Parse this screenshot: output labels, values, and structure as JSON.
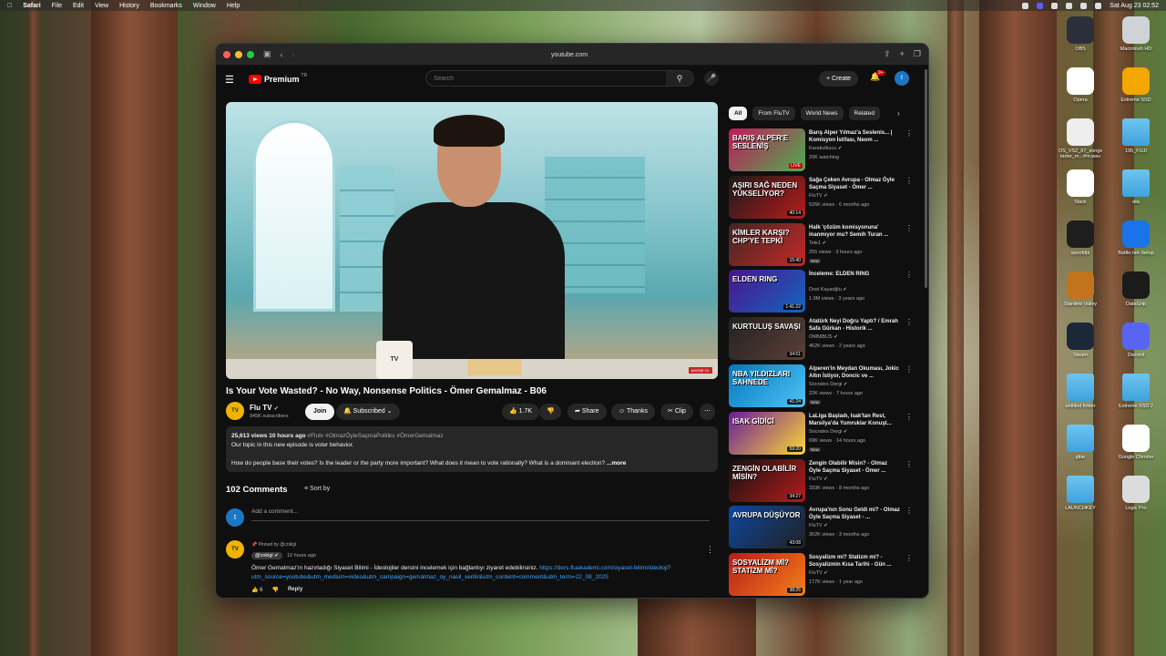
{
  "menubar": {
    "app": "Safari",
    "items": [
      "File",
      "Edit",
      "View",
      "History",
      "Bookmarks",
      "Window",
      "Help"
    ],
    "clock": "Sat Aug 23  02:52"
  },
  "browser": {
    "url": "youtube.com"
  },
  "yt": {
    "logo": "Premium",
    "logo_country": "TR",
    "search_placeholder": "Search",
    "create_label": "Create",
    "notif_count": "9+",
    "avatar_letter": "t"
  },
  "video": {
    "mug_text": "TV",
    "badge": "ABONE OL",
    "title": "Is Your Vote Wasted? - No Way, Nonsense Politics - Ömer Gemalmaz - B06",
    "channel": "Flu TV",
    "channel_avatar": "TV",
    "subs": "945K subscribers",
    "join": "Join",
    "subscribed": "Subscribed",
    "likes": "1.7K",
    "share": "Share",
    "thanks": "Thanks",
    "clip": "Clip"
  },
  "description": {
    "meta": "25,613 views  10 hours ago",
    "tags": "#Flutv #OlmazÖyleSaçmaPolitiks #ÖmerGemalmaz",
    "line1": "Our topic in this new episode is voter behavior.",
    "line2": "How do people base their votes? Is the leader or the party more important? What does it mean to vote rationally? What is a dominant election?",
    "more": "...more"
  },
  "comments": {
    "header": "102 Comments",
    "sort": "Sort by",
    "my_avatar": "t",
    "add_placeholder": "Add a comment...",
    "pinned_by": "Pinned by @cnklgl",
    "author": "@cnklgl",
    "time": "10 hours ago",
    "text": "Ömer Gemalmaz'ın hazırladığı Siyaset Bilimi - İdeolojiler dersini incelemek için bağlantıyı ziyaret edebilirsiniz.",
    "link": "https://ders.fluakademi.com/siyaset-bilimi/ideoloji?utm_source=youtube&utm_medium=video&utm_campaign=gemalmaz_oy_nasil_verilir&utm_content=comment&utm_term=22_08_2025",
    "likes": "6",
    "reply": "Reply"
  },
  "chips": [
    "All",
    "From FluTV",
    "World News",
    "Related"
  ],
  "recommendations": [
    {
      "title": "Barış Alper Yılmaz'a Seslenis... | Komisyon İstifası, Neom ...",
      "channel": "Karakulkucu",
      "meta": "20K watching",
      "thumb_text": "BARIŞ ALPER'E SESLENİŞ",
      "dur": "LIVE",
      "new": "",
      "c1": "#c2185b",
      "c2": "#4caf50"
    },
    {
      "title": "Sağa Çeken Avrupa - Olmaz Öyle Saçma Siyaset - Ömer ...",
      "channel": "FluTV",
      "meta": "526K views · 6 months ago",
      "thumb_text": "AŞIRI SAĞ NEDEN YÜKSELİYOR?",
      "dur": "40:14",
      "new": "",
      "c1": "#1a1a1a",
      "c2": "#b71c1c"
    },
    {
      "title": "Halk 'çözüm komisyonuna' inanmıyor mu? Semih Turan ...",
      "channel": "Tele1",
      "meta": "255 views · 3 hours ago",
      "thumb_text": "KİMLER KARŞI? CHP'YE TEPKİ",
      "dur": "15:40",
      "new": "New",
      "c1": "#3e2723",
      "c2": "#c62828"
    },
    {
      "title": "İnceleme: ELDEN RING",
      "channel": "Dost Kayaoğlu",
      "meta": "1.9M views · 3 years ago",
      "thumb_text": "ELDEN RING",
      "dur": "1:41:22",
      "new": "",
      "c1": "#4a148c",
      "c2": "#1565c0"
    },
    {
      "title": "Atatürk Neyi Doğru Yaptı? / Emrah Safa Gürkan - Historik ...",
      "channel": "OMNIBUS",
      "meta": "452K views · 2 years ago",
      "thumb_text": "KURTULUŞ SAVAŞI",
      "dur": "34:51",
      "new": "",
      "c1": "#212121",
      "c2": "#5d4037"
    },
    {
      "title": "Alperen'in Meydan Okuması, Jokic Altın İstiyor, Doncic ve ...",
      "channel": "Socrates Dergi",
      "meta": "22K views · 7 hours ago",
      "thumb_text": "NBA YILDIZLARI SAHNEDE",
      "dur": "41:24",
      "new": "New",
      "c1": "#0277bd",
      "c2": "#4fc3f7"
    },
    {
      "title": "LaLiga Başladı, Isak'tan Rest, Marsilya'da Yumruklar Konuşt...",
      "channel": "Socrates Dergi",
      "meta": "69K views · 14 hours ago",
      "thumb_text": "ISAK GİDİCİ",
      "dur": "59:20",
      "new": "New",
      "c1": "#6a1b9a",
      "c2": "#fdd835"
    },
    {
      "title": "Zengin Olabilir Misin? - Olmaz Öyle Saçma Siyaset - Ömer ...",
      "channel": "FluTV",
      "meta": "333K views · 8 months ago",
      "thumb_text": "ZENGİN OLABİLİR MİSİN?",
      "dur": "34:27",
      "new": "",
      "c1": "#111111",
      "c2": "#b71c1c"
    },
    {
      "title": "Avrupa'nın Sonu Geldi mi? - Olmaz Öyle Saçma Siyaset - ...",
      "channel": "FluTV",
      "meta": "362K views · 3 months ago",
      "thumb_text": "AVRUPA DÜŞÜYOR",
      "dur": "43:08",
      "new": "",
      "c1": "#0d47a1",
      "c2": "#212121"
    },
    {
      "title": "Sosyalizm mi? Statizm mi? - Sosyalizmin Kısa Tarihi - Gün ...",
      "channel": "FluTV",
      "meta": "177K views · 1 year ago",
      "thumb_text": "SOSYALİZM Mİ? STATİZM Mİ?",
      "dur": "38:25",
      "new": "",
      "c1": "#b71c1c",
      "c2": "#f57f17"
    }
  ],
  "desktop": [
    {
      "label": "OBS",
      "color": "#2b2f38"
    },
    {
      "label": "Macintosh HD",
      "color": "#cfd3d8"
    },
    {
      "label": "Opera",
      "color": "#ffffff"
    },
    {
      "label": "Extreme SSD",
      "color": "#f3a700"
    },
    {
      "label": "OS_VS2_87_songs tarter_m...#m.wav",
      "color": "#eeeeee"
    },
    {
      "label": "195_FUJI",
      "color": "#4cb0e6"
    },
    {
      "label": "Slack",
      "color": "#ffffff"
    },
    {
      "label": "ata",
      "color": "#4cb0e6"
    },
    {
      "label": "spoofdpi",
      "color": "#1e1e1e"
    },
    {
      "label": "Battle.net-Setup",
      "color": "#1a73e8"
    },
    {
      "label": "Stardew Valley",
      "color": "#c2731e"
    },
    {
      "label": "DataGrip",
      "color": "#1b1b1b"
    },
    {
      "label": "Steam",
      "color": "#1b2838"
    },
    {
      "label": "Discord",
      "color": "#5865f2"
    },
    {
      "label": "untitled folder",
      "color": "#4cb0e6"
    },
    {
      "label": "Extreme SSD 2",
      "color": "#4cb0e6"
    },
    {
      "label": "gitar",
      "color": "#4cb0e6"
    },
    {
      "label": "Google Chrome",
      "color": "#ffffff"
    },
    {
      "label": "LAUNCHKEY",
      "color": "#4cb0e6"
    },
    {
      "label": "Logic Pro",
      "color": "#dcdcdc"
    }
  ]
}
